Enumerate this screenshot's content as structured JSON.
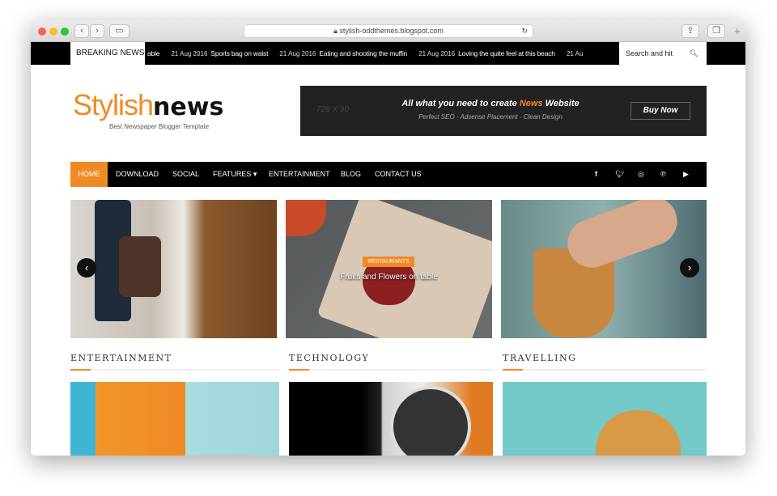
{
  "browser": {
    "url": "stylish-oddthemes.blogspot.com"
  },
  "ticker": {
    "label": "BREAKING NEWS",
    "items": [
      {
        "date": "",
        "title": "able"
      },
      {
        "date": "21 Aug 2016",
        "title": "Sports bag on waist"
      },
      {
        "date": "21 Aug 2016",
        "title": "Eating and shooting the muffin"
      },
      {
        "date": "21 Aug 2016",
        "title": "Loving the quite feel at this beach"
      },
      {
        "date": "21 Au",
        "title": ""
      }
    ],
    "search_placeholder": "Search and hit"
  },
  "logo": {
    "part1": "Stylish",
    "part2": "news",
    "tagline": "Best Newspaper Blogger Template"
  },
  "ad": {
    "size": "728 X 90",
    "headline_pre": "All what you need to create ",
    "headline_accent": "News",
    "headline_post": " Website",
    "sub": "Perfect SEO - Adsense Placement - Clean Design",
    "button": "Buy Now"
  },
  "nav": {
    "items": [
      "HOME",
      "DOWNLOAD",
      "SOCIAL",
      "FEATURES ▾",
      "ENTERTAINMENT",
      "BLOG",
      "CONTACT US"
    ],
    "social": [
      "facebook-icon",
      "twitter-icon",
      "instagram-icon",
      "pinterest-icon",
      "youtube-icon"
    ]
  },
  "slider": {
    "badge": "RESTAURANTS",
    "title": "Fruits and Flowers on table"
  },
  "sections": [
    "ENTERTAINMENT",
    "TECHNOLOGY",
    "TRAVELLING"
  ],
  "colors": {
    "accent": "#f08a24",
    "dark": "#000000"
  }
}
